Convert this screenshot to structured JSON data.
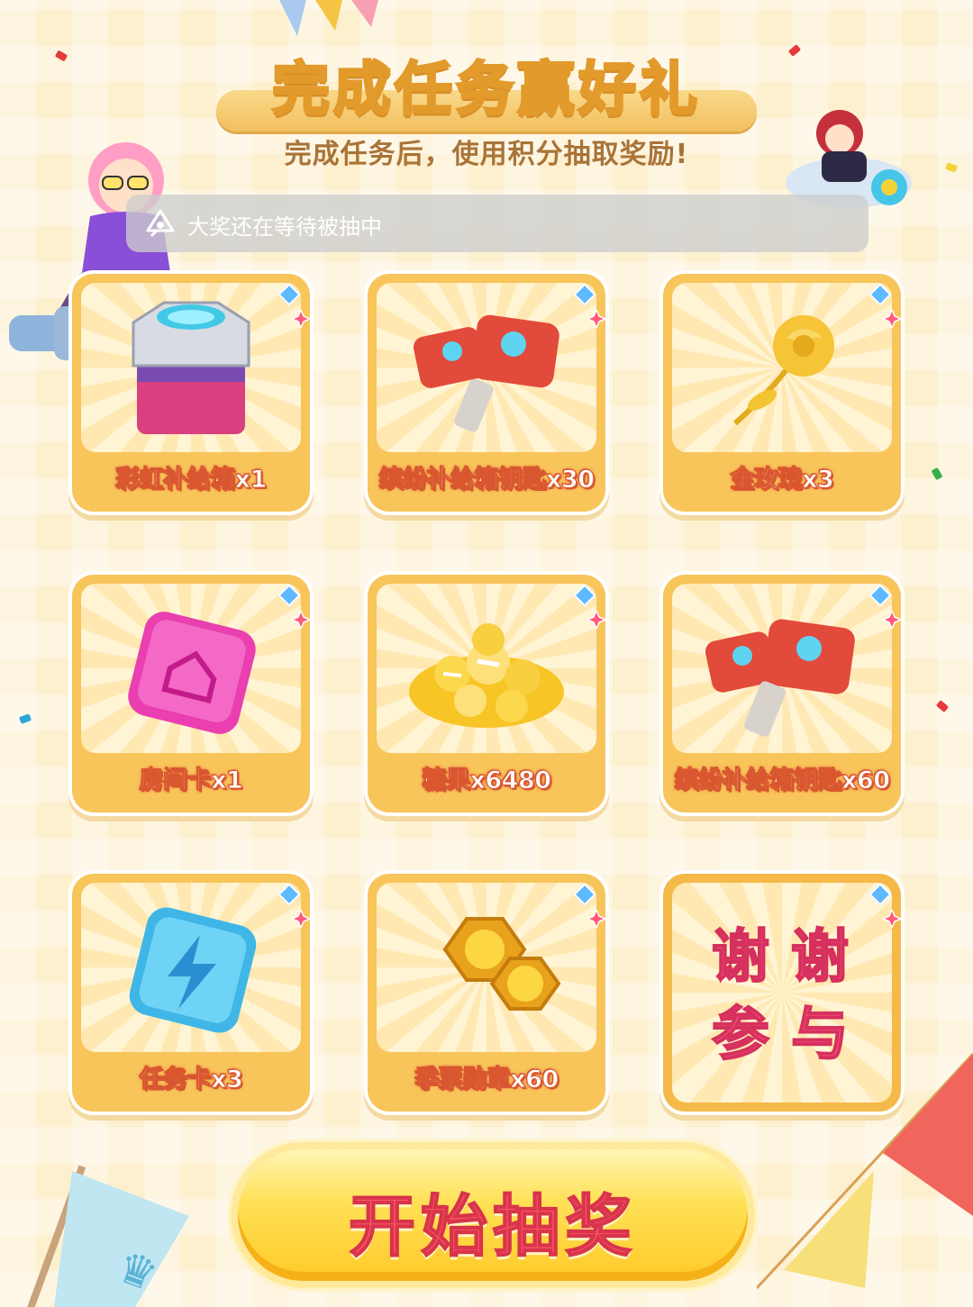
{
  "header": {
    "title": "完成任务赢好礼",
    "subtitle": "完成任务后，使用积分抽取奖励!"
  },
  "notice": {
    "text": "大奖还在等待被抽中",
    "icon": "megaphone-icon"
  },
  "prizes": [
    {
      "label": "彩虹补给箱x1",
      "icon": "rainbow-supply-box-icon"
    },
    {
      "label": "缤纷补给箱钥匙x30",
      "icon": "supply-key-icon"
    },
    {
      "label": "金玫瑰x3",
      "icon": "golden-rose-icon"
    },
    {
      "label": "房间卡x1",
      "icon": "room-card-icon"
    },
    {
      "label": "糖果x6480",
      "icon": "candy-pile-icon"
    },
    {
      "label": "缤纷补给箱钥匙x60",
      "icon": "supply-key-icon"
    },
    {
      "label": "任务卡x3",
      "icon": "task-card-icon"
    },
    {
      "label": "季票勋章x60",
      "icon": "season-medal-icon"
    },
    {
      "line1": "谢谢",
      "line2": "参与",
      "icon": "thanks-text"
    }
  ],
  "action": {
    "start_label": "开始抽奖"
  },
  "colors": {
    "background": "#fdf0cf",
    "card": "#f8c55a",
    "label_stroke": "#d9572f",
    "button": "#ffd43d",
    "button_text": "#ff5a6a"
  }
}
